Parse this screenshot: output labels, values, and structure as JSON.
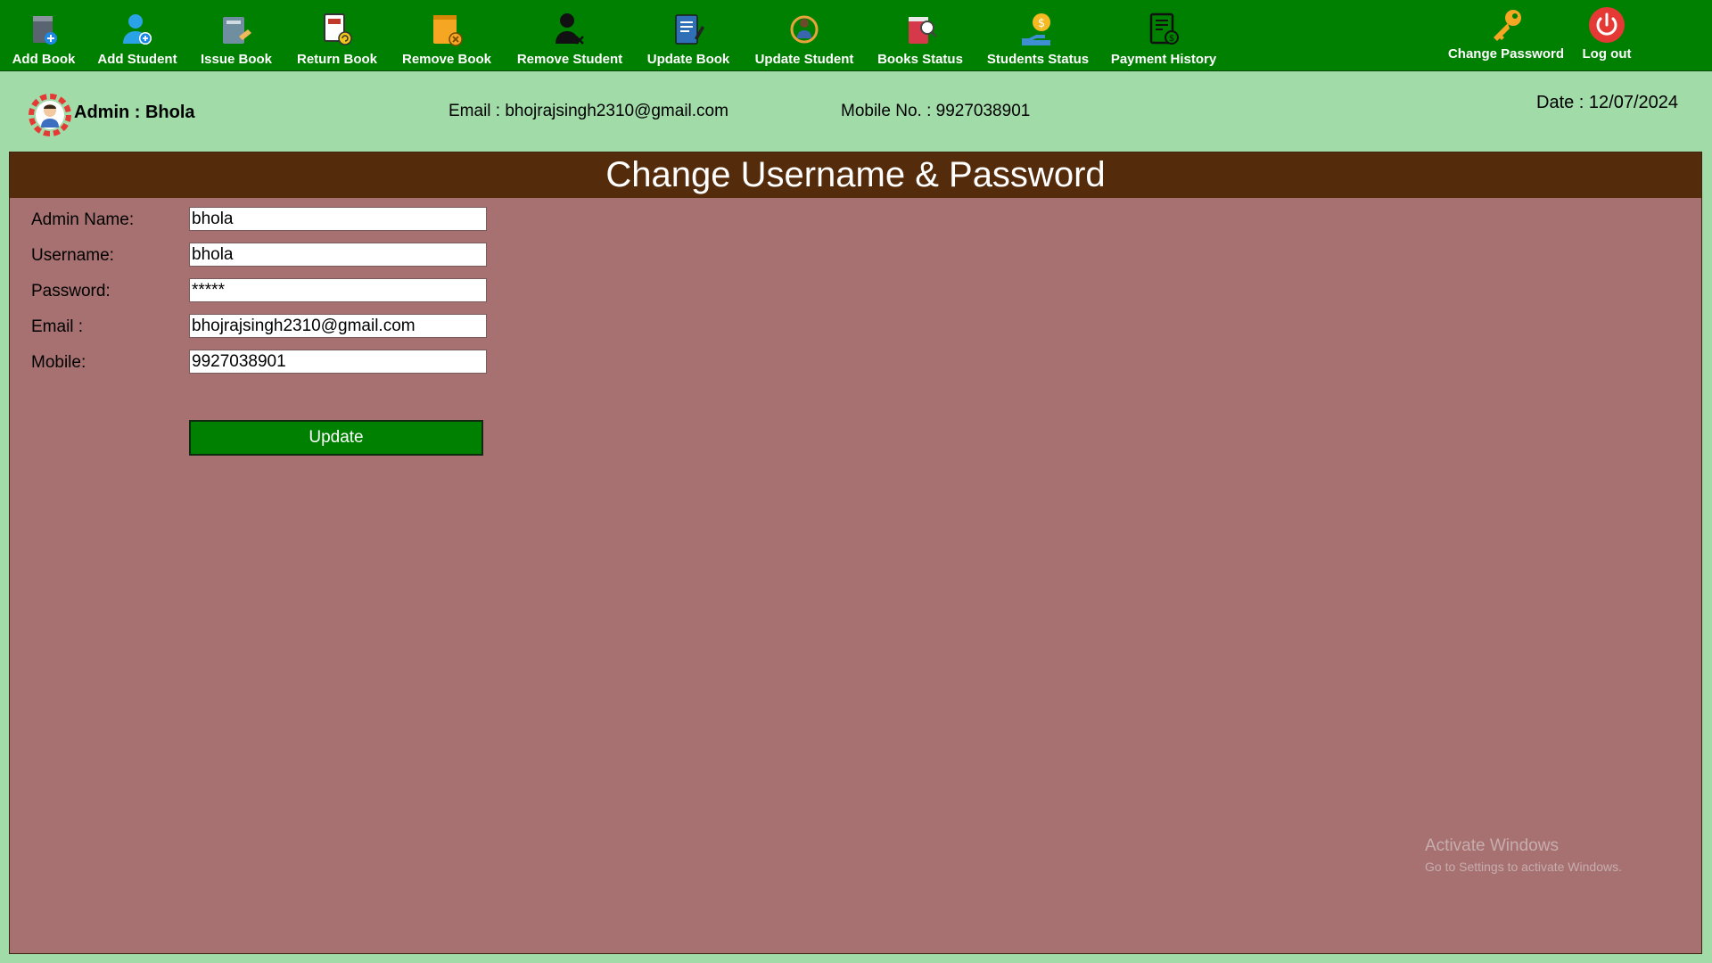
{
  "toolbar": {
    "items": [
      {
        "label": "Add Book",
        "icon": "add-book-icon"
      },
      {
        "label": "Add Student",
        "icon": "add-student-icon"
      },
      {
        "label": "Issue Book",
        "icon": "issue-book-icon"
      },
      {
        "label": "Return Book",
        "icon": "return-book-icon"
      },
      {
        "label": "Remove Book",
        "icon": "remove-book-icon"
      },
      {
        "label": "Remove Student",
        "icon": "remove-student-icon"
      },
      {
        "label": "Update Book",
        "icon": "update-book-icon"
      },
      {
        "label": "Update Student",
        "icon": "update-student-icon"
      },
      {
        "label": "Books Status",
        "icon": "books-status-icon"
      },
      {
        "label": "Students Status",
        "icon": "students-status-icon"
      },
      {
        "label": "Payment History",
        "icon": "payment-history-icon"
      }
    ],
    "change_password": {
      "label": "Change Password",
      "icon": "key-icon"
    },
    "logout": {
      "label": "Log out",
      "icon": "power-icon"
    }
  },
  "info": {
    "admin": "Admin : Bhola",
    "email": "Email : bhojrajsingh2310@gmail.com",
    "mobile": "Mobile No. : 9927038901",
    "date": "Date : 12/07/2024"
  },
  "panel": {
    "title": "Change Username & Password",
    "fields": [
      {
        "label": "Admin Name:",
        "value": "bhola"
      },
      {
        "label": "Username:",
        "value": "bhola"
      },
      {
        "label": "Password:",
        "value": "*****"
      },
      {
        "label": "Email :",
        "value": "bhojrajsingh2310@gmail.com"
      },
      {
        "label": "Mobile:",
        "value": "9927038901"
      }
    ],
    "update_label": "Update"
  },
  "watermark": {
    "line1": "Activate Windows",
    "line2": "Go to Settings to activate Windows."
  },
  "colors": {
    "toolbar": "#008000",
    "background": "#a0dba8",
    "panel": "#a77171",
    "panel_header": "#542c0c",
    "button": "#008000"
  }
}
